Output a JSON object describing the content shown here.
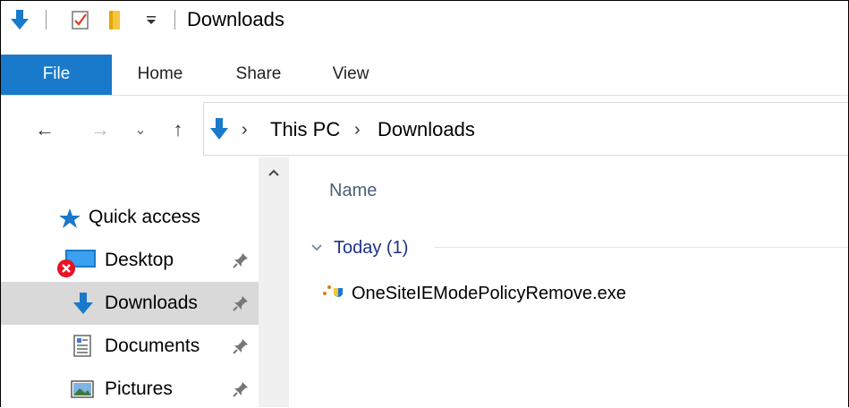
{
  "window": {
    "title": "Downloads"
  },
  "quick_access_toolbar": {
    "icons": [
      "download-arrow-icon",
      "properties-checkbox-icon",
      "new-folder-icon",
      "customize-dropdown-icon"
    ]
  },
  "ribbon": {
    "tabs": [
      {
        "label": "File",
        "active": true
      },
      {
        "label": "Home"
      },
      {
        "label": "Share"
      },
      {
        "label": "View"
      }
    ]
  },
  "navigation": {
    "back": "←",
    "forward": "→",
    "recent": "⌄",
    "up": "↑"
  },
  "address_bar": {
    "breadcrumbs": [
      "This PC",
      "Downloads"
    ],
    "separator": "›"
  },
  "nav_pane": {
    "items": [
      {
        "label": "Quick access",
        "icon": "star-icon",
        "pinned": false
      },
      {
        "label": "Desktop",
        "icon": "desktop-icon",
        "pinned": true,
        "error_overlay": true
      },
      {
        "label": "Downloads",
        "icon": "download-arrow-icon",
        "pinned": true,
        "selected": true
      },
      {
        "label": "Documents",
        "icon": "documents-icon",
        "pinned": true
      },
      {
        "label": "Pictures",
        "icon": "pictures-icon",
        "pinned": true
      }
    ]
  },
  "content": {
    "column_header": "Name",
    "groups": [
      {
        "label": "Today (1)",
        "files": [
          {
            "name": "OneSiteIEModePolicyRemove.exe",
            "icon": "exe-shield-icon"
          }
        ]
      }
    ]
  },
  "colors": {
    "accent": "#1979ca",
    "selected_bg": "#d9d9d9",
    "group_text": "#1e3287",
    "header_text": "#4c607a",
    "error_red": "#e81123"
  }
}
